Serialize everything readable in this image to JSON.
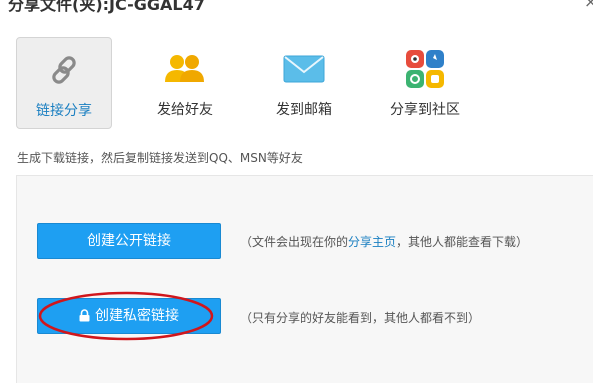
{
  "window": {
    "title": "分享文件(夹):JC-GGAL47",
    "close_icon": "close-icon"
  },
  "tabs": [
    {
      "label": "链接分享",
      "icon": "link-icon",
      "active": true
    },
    {
      "label": "发给好友",
      "icon": "friends-icon",
      "active": false
    },
    {
      "label": "发到邮箱",
      "icon": "mail-icon",
      "active": false
    },
    {
      "label": "分享到社区",
      "icon": "community-icon",
      "active": false
    }
  ],
  "hint": "生成下载链接，然后复制链接发送到QQ、MSN等好友",
  "public": {
    "button_label": "创建公开链接",
    "desc_before": "（文件会出现在你的",
    "desc_link": "分享主页",
    "desc_after": "，其他人都能查看下载）"
  },
  "private": {
    "button_label": "创建私密链接",
    "lock_icon": "lock-icon",
    "desc": "（只有分享的好友能看到，其他人都看不到）"
  },
  "colors": {
    "accent": "#1e9ff2",
    "link": "#1a7fc1",
    "annotation": "#d0161c"
  }
}
